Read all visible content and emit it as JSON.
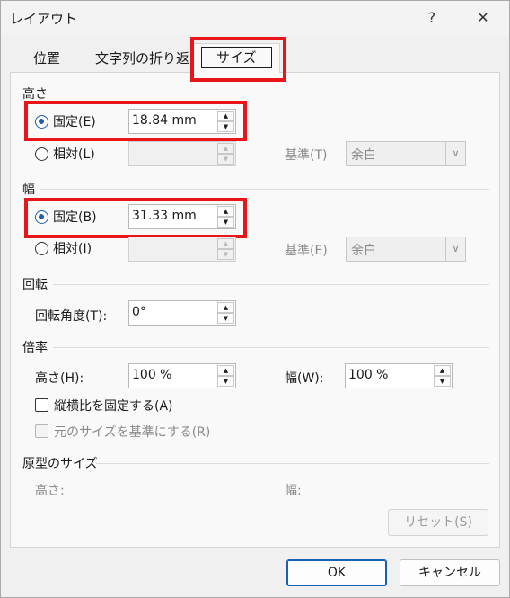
{
  "window": {
    "title": "レイアウト",
    "help": "?",
    "close": "✕"
  },
  "tabs": [
    {
      "label": "位置"
    },
    {
      "label": "文字列の折り返し"
    },
    {
      "label": "サイズ"
    }
  ],
  "height": {
    "section": "高さ",
    "absolute_label": "固定(E)",
    "absolute_value": "18.84 mm",
    "relative_label": "相対(L)",
    "relative_to_label": "基準(T)",
    "relative_to_value": "余白"
  },
  "width": {
    "section": "幅",
    "absolute_label": "固定(B)",
    "absolute_value": "31.33 mm",
    "relative_label": "相対(I)",
    "relative_to_label": "基準(E)",
    "relative_to_value": "余白"
  },
  "rotate": {
    "section": "回転",
    "rotation_label": "回転角度(T):",
    "rotation_value": "0°"
  },
  "scale": {
    "section": "倍率",
    "height_label": "高さ(H):",
    "height_value": "100 %",
    "width_label": "幅(W):",
    "width_value": "100 %",
    "lock_aspect_label": "縦横比を固定する(A)",
    "relative_original_label": "元のサイズを基準にする(R)"
  },
  "original": {
    "section": "原型のサイズ",
    "height_label": "高さ:",
    "width_label": "幅:",
    "reset_label": "リセット(S)"
  },
  "footer": {
    "ok": "OK",
    "cancel": "キャンセル"
  },
  "accent_color": "#1a5fb4",
  "highlight_color": "#e8161a"
}
